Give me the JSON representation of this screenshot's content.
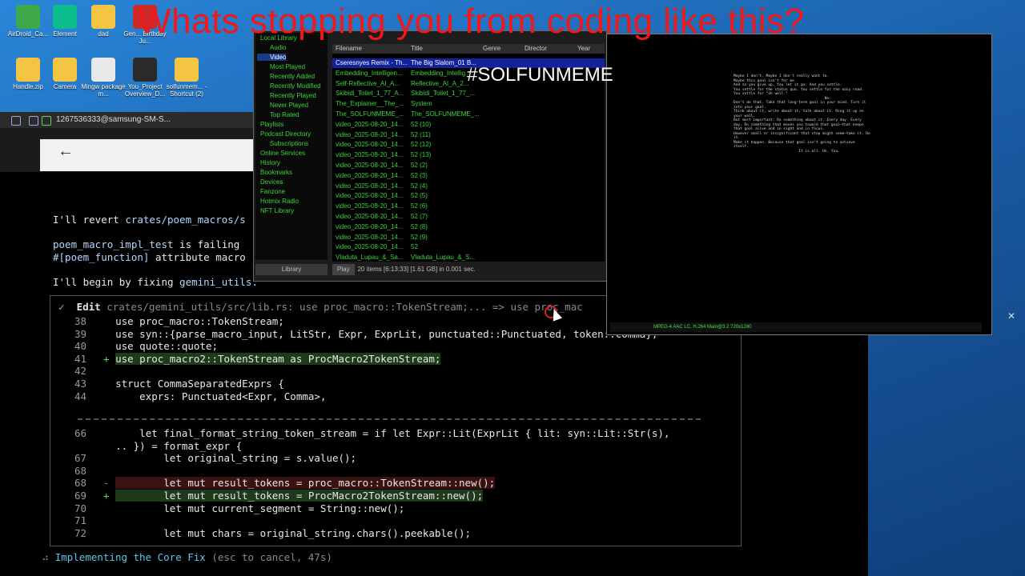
{
  "meme": {
    "title": "Whats stopping you from coding like this?",
    "hashtag": "#SOLFUNMEME"
  },
  "desktop_icons": [
    {
      "label": "AirDroid_Ca...",
      "color": "#3fa84a"
    },
    {
      "label": "Element",
      "color": "#0dbd8b"
    },
    {
      "label": "dad",
      "color": "#f4c542"
    },
    {
      "label": "Gen... Birthday Ju...",
      "color": "#cc2a2a"
    },
    {
      "label": "Handle.zip",
      "color": "#f4c542"
    },
    {
      "label": "Camera",
      "color": "#f4c542"
    },
    {
      "label": "Mingw package m...",
      "color": "#e8e8e8"
    },
    {
      "label": "You_Project Overview_D...",
      "color": "#2a2a2a"
    },
    {
      "label": "solfunmem... - Shortcut (2)",
      "color": "#f4c542"
    }
  ],
  "browser": {
    "tab_title": "1267536333@samsung-SM-S..."
  },
  "terminal": {
    "line1_prefix": "I'll revert ",
    "line1_path": "crates/poem_macros/s",
    "line2_a": "poem_macro_impl_test",
    "line2_b": " is failing",
    "line3_a": "#[poem_function]",
    "line3_b": " attribute macro",
    "line4_a": "I'll begin by fixing ",
    "line4_b": "gemini_utils.",
    "edit_check": "✓",
    "edit_label": "Edit",
    "edit_target": "crates/gemini_utils/src/lib.rs: use proc_macro::TokenStream;... => use proc_mac",
    "code_lines": [
      {
        "num": "38",
        "mark": " ",
        "text": "use proc_macro::TokenStream;",
        "kind": "normal"
      },
      {
        "num": "39",
        "mark": " ",
        "text": "use syn::{parse_macro_input, LitStr, Expr, ExprLit, punctuated::Punctuated, token::Comma};",
        "kind": "normal"
      },
      {
        "num": "40",
        "mark": " ",
        "text": "use quote::quote;",
        "kind": "normal"
      },
      {
        "num": "41",
        "mark": "+",
        "text": "use proc_macro2::TokenStream as ProcMacro2TokenStream;",
        "kind": "add"
      },
      {
        "num": "42",
        "mark": " ",
        "text": "",
        "kind": "normal"
      },
      {
        "num": "43",
        "mark": " ",
        "text": "struct CommaSeparatedExprs {",
        "kind": "normal"
      },
      {
        "num": "44",
        "mark": " ",
        "text": "    exprs: Punctuated<Expr, Comma>,",
        "kind": "normal"
      }
    ],
    "code_lines2": [
      {
        "num": "66",
        "mark": " ",
        "text": "    let final_format_string_token_stream = if let Expr::Lit(ExprLit { lit: syn::Lit::Str(s),",
        "kind": "normal"
      },
      {
        "num": "",
        "mark": " ",
        "text": ".. }) = format_expr {",
        "kind": "normal"
      },
      {
        "num": "67",
        "mark": " ",
        "text": "        let original_string = s.value();",
        "kind": "normal"
      },
      {
        "num": "68",
        "mark": " ",
        "text": "",
        "kind": "normal"
      },
      {
        "num": "68",
        "mark": "-",
        "text": "        let mut result_tokens = proc_macro::TokenStream::new();",
        "kind": "del"
      },
      {
        "num": "69",
        "mark": "+",
        "text": "        let mut result_tokens = ProcMacro2TokenStream::new();",
        "kind": "add"
      },
      {
        "num": "70",
        "mark": " ",
        "text": "        let mut current_segment = String::new();",
        "kind": "normal"
      },
      {
        "num": "71",
        "mark": " ",
        "text": "",
        "kind": "normal"
      },
      {
        "num": "72",
        "mark": " ",
        "text": "        let mut chars = original_string.chars().peekable();",
        "kind": "normal"
      }
    ],
    "status_spinner": "⠴",
    "status_text": "Implementing the Core Fix",
    "status_hint": "(esc to cancel, 47s)"
  },
  "player": {
    "sidebar": [
      {
        "label": "Local Library",
        "sel": false
      },
      {
        "label": "Audio",
        "sel": false
      },
      {
        "label": "Video",
        "sel": true
      },
      {
        "label": "Most Played",
        "sel": false
      },
      {
        "label": "Recently Added",
        "sel": false
      },
      {
        "label": "Recently Modified",
        "sel": false
      },
      {
        "label": "Recently Played",
        "sel": false
      },
      {
        "label": "Never Played",
        "sel": false
      },
      {
        "label": "Top Rated",
        "sel": false
      },
      {
        "label": "Playlists",
        "sel": false
      },
      {
        "label": "Podcast Directory",
        "sel": false
      },
      {
        "label": "Subscriptions",
        "sel": false
      },
      {
        "label": "Online Services",
        "sel": false
      },
      {
        "label": "History",
        "sel": false
      },
      {
        "label": "Bookmarks",
        "sel": false
      },
      {
        "label": "Devices",
        "sel": false
      },
      {
        "label": "Fanzone",
        "sel": false
      },
      {
        "label": "Hotmix Radio",
        "sel": false
      },
      {
        "label": "NFT Library",
        "sel": false
      }
    ],
    "library_button": "Library",
    "columns": [
      "Filename",
      "Title",
      "Genre",
      "Director",
      "Year"
    ],
    "rows": [
      {
        "file": "Cseresnyes Remix - Th...",
        "title": "The Big Slalom_01 B...",
        "sel": true
      },
      {
        "file": "Embedding_Intelligen...",
        "title": "Embedding_Intellig...",
        "sel": false
      },
      {
        "file": "Self-Reflective_AI_A...",
        "title": "Reflective_AI_A_2...",
        "sel": false
      },
      {
        "file": "Skibidi_Toilet_1_77_A...",
        "title": "Skibidi_Toilet_1_77_...",
        "sel": false
      },
      {
        "file": "The_Explainer__The_...",
        "title": "System",
        "sel": false
      },
      {
        "file": "The_SOLFUNMEME_...",
        "title": "The_SOLFUNMEME_...",
        "sel": false
      },
      {
        "file": "video_2025-08-20_14...",
        "title": "52 (10)",
        "sel": false
      },
      {
        "file": "video_2025-08-20_14...",
        "title": "52 (11)",
        "sel": false
      },
      {
        "file": "video_2025-08-20_14...",
        "title": "52 (12)",
        "sel": false
      },
      {
        "file": "video_2025-08-20_14...",
        "title": "52 (13)",
        "sel": false
      },
      {
        "file": "video_2025-08-20_14...",
        "title": "52 (2)",
        "sel": false
      },
      {
        "file": "video_2025-08-20_14...",
        "title": "52 (3)",
        "sel": false
      },
      {
        "file": "video_2025-08-20_14...",
        "title": "52 (4)",
        "sel": false
      },
      {
        "file": "video_2025-08-20_14...",
        "title": "52 (5)",
        "sel": false
      },
      {
        "file": "video_2025-08-20_14...",
        "title": "52 (6)",
        "sel": false
      },
      {
        "file": "video_2025-08-20_14...",
        "title": "52 (7)",
        "sel": false
      },
      {
        "file": "video_2025-08-20_14...",
        "title": "52 (8)",
        "sel": false
      },
      {
        "file": "video_2025-08-20_14...",
        "title": "52 (9)",
        "sel": false
      },
      {
        "file": "video_2025-08-20_14...",
        "title": "52",
        "sel": false
      },
      {
        "file": "Vladuta_Lupau_&_Sa...",
        "title": "Vladuta_Lupau_&_S...",
        "sel": false
      }
    ],
    "play_button": "Play",
    "summary": "20 items [6:13:33] [1.61 GB] in 0.001 sec."
  },
  "video": {
    "subtitle_text": "Maybe I don't. Maybe I don't really want to.\nMaybe this goal isn't for me.\nAnd so you give up. You let it go. And you settle.\nYou settle for the status quo. You settle for the easy road.\nYou settle for \"oh well.\"\n                                          No.\nDon't do that. Take that long-term goal in your mind. Turn it\ninto your goal.\nThink about it, write about it, talk about it. Ring it up on\nyour wall.\nBut most important: Do something about it. Every day. Every\nday. Do something that moves you toward that goal—that keeps\nthat goal alive and in sight and in focus.\nHowever small or insignificant that step might seem—take it. Do\nit.\nMake it happen. Because that goal isn't going to achieve\nitself.\n                              It is all. On. You.",
    "status": "MPEG-4 AAC LC, H.264 Main@3.2 720x1280"
  }
}
